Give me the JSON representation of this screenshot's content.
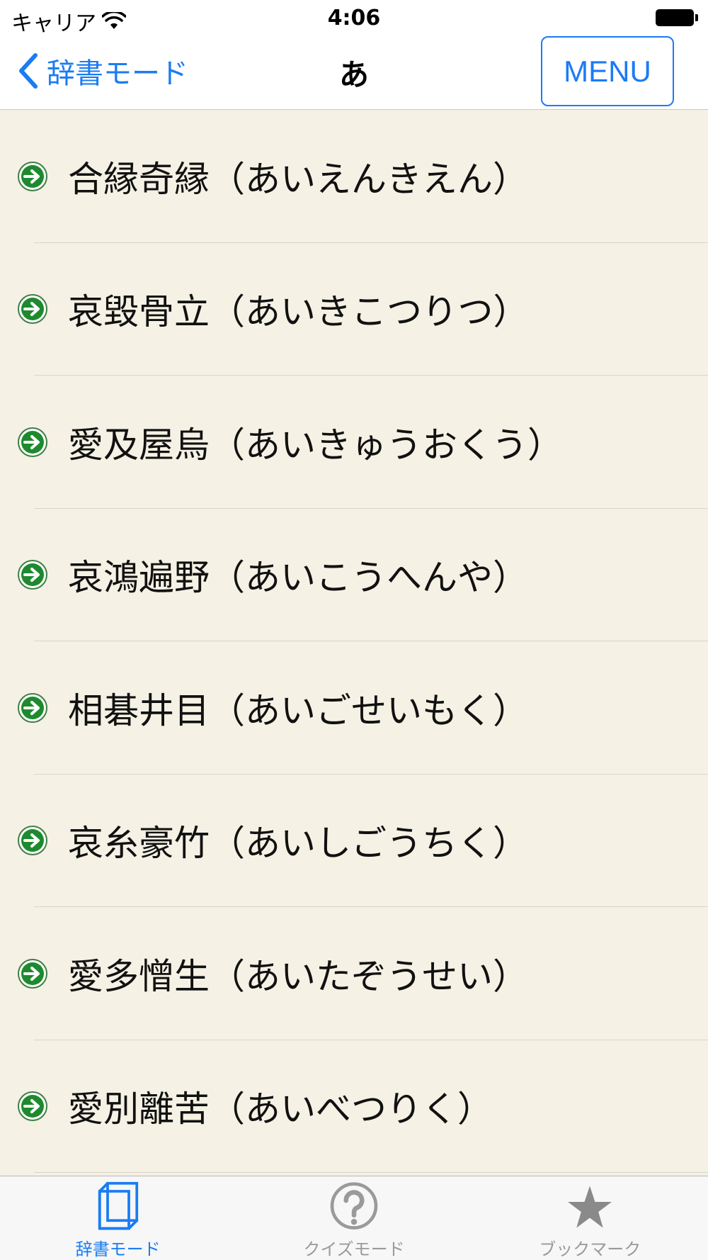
{
  "status_bar": {
    "carrier": "キャリア",
    "time": "4:06"
  },
  "nav": {
    "back_label": "辞書モード",
    "title": "あ",
    "menu_label": "MENU"
  },
  "list": {
    "items": [
      {
        "label": "合縁奇縁（あいえんきえん）"
      },
      {
        "label": "哀毀骨立（あいきこつりつ）"
      },
      {
        "label": "愛及屋烏（あいきゅうおくう）"
      },
      {
        "label": "哀鴻遍野（あいこうへんや）"
      },
      {
        "label": "相碁井目（あいごせいもく）"
      },
      {
        "label": "哀糸豪竹（あいしごうちく）"
      },
      {
        "label": "愛多憎生（あいたぞうせい）"
      },
      {
        "label": "愛別離苦（あいべつりく）"
      }
    ]
  },
  "tab_bar": {
    "tabs": [
      {
        "label": "辞書モード",
        "icon": "book-icon",
        "active": true
      },
      {
        "label": "クイズモード",
        "icon": "question-icon",
        "active": false
      },
      {
        "label": "ブックマーク",
        "icon": "star-icon",
        "active": false
      }
    ]
  },
  "colors": {
    "accent": "#1a7cf4",
    "list_background": "#f5f1e4",
    "arrow_green": "#1e8a2e",
    "tab_inactive": "#9a9a9a"
  }
}
